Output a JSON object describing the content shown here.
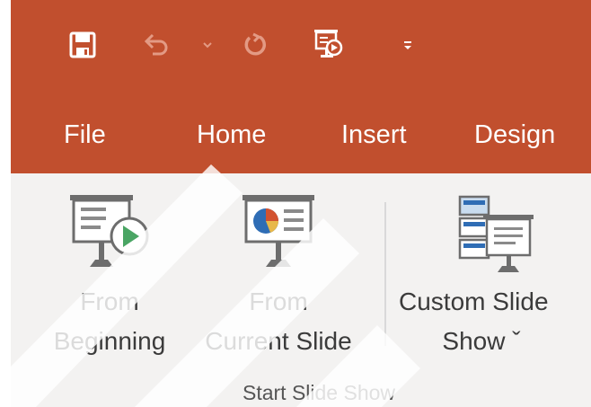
{
  "quick_access": {
    "save_icon": "save-icon",
    "undo_icon": "undo-icon",
    "undo_dropdown_icon": "chevron-down-icon",
    "redo_icon": "redo-icon",
    "start_from_beginning_icon": "slideshow-from-beginning-icon",
    "customize_icon": "customize-toolbar-icon"
  },
  "tabs": [
    {
      "label": "File"
    },
    {
      "label": "Home"
    },
    {
      "label": "Insert"
    },
    {
      "label": "Design"
    }
  ],
  "ribbon": {
    "group_label": "Start Slide Show",
    "commands": {
      "from_beginning": {
        "line1": "From",
        "line2": "Beginning",
        "icon": "projector-play-icon"
      },
      "from_current": {
        "line1": "From",
        "line2": "Current Slide",
        "icon": "projector-chart-icon"
      },
      "custom_show": {
        "line1": "Custom Slide",
        "line2": "Show ˇ",
        "icon": "custom-slide-show-icon"
      }
    }
  },
  "colors": {
    "accent": "#c14f2e",
    "ribbon_bg": "#f3f2f1",
    "play_green": "#4aa564",
    "chart_blue": "#2f6db5",
    "chart_orange": "#d35230"
  }
}
